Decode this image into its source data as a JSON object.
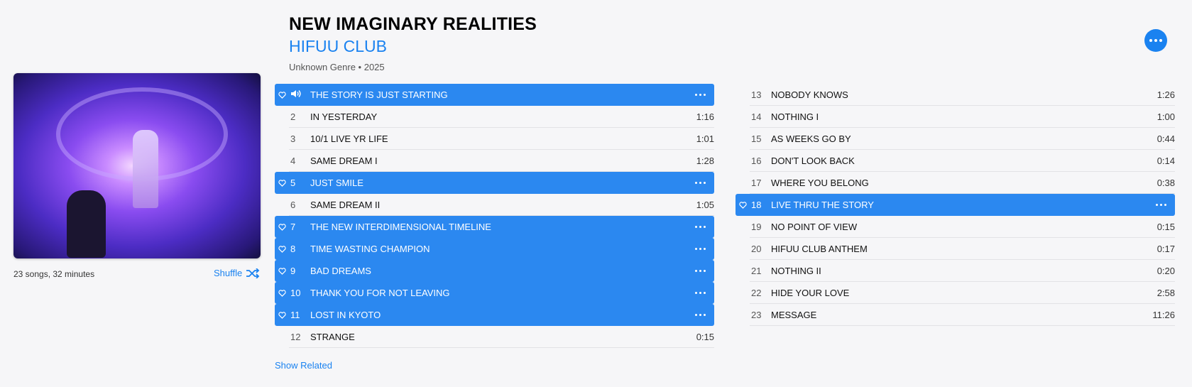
{
  "album": {
    "title": "NEW IMAGINARY REALITIES",
    "artist": "HIFUU CLUB",
    "meta": "Unknown Genre • 2025",
    "summary": "23 songs, 32 minutes",
    "shuffle_label": "Shuffle",
    "show_related_label": "Show Related"
  },
  "colors": {
    "accent": "#1a82f0",
    "selected_row": "#2b88f0"
  },
  "now_playing_icon": "speaker-icon",
  "tracks_left": [
    {
      "num": "",
      "title": "THE STORY IS JUST STARTING",
      "duration": "",
      "selected": true,
      "playing": true
    },
    {
      "num": "2",
      "title": "IN YESTERDAY",
      "duration": "1:16",
      "selected": false
    },
    {
      "num": "3",
      "title": "10/1 LIVE YR LIFE",
      "duration": "1:01",
      "selected": false
    },
    {
      "num": "4",
      "title": "SAME DREAM I",
      "duration": "1:28",
      "selected": false
    },
    {
      "num": "5",
      "title": "JUST SMILE",
      "duration": "",
      "selected": true
    },
    {
      "num": "6",
      "title": "SAME DREAM II",
      "duration": "1:05",
      "selected": false
    },
    {
      "num": "7",
      "title": "THE NEW INTERDIMENSIONAL TIMELINE",
      "duration": "",
      "selected": true
    },
    {
      "num": "8",
      "title": "TIME WASTING CHAMPION",
      "duration": "",
      "selected": true
    },
    {
      "num": "9",
      "title": "BAD DREAMS",
      "duration": "",
      "selected": true
    },
    {
      "num": "10",
      "title": "THANK YOU FOR NOT LEAVING",
      "duration": "",
      "selected": true
    },
    {
      "num": "11",
      "title": "LOST IN KYOTO",
      "duration": "",
      "selected": true
    },
    {
      "num": "12",
      "title": "STRANGE",
      "duration": "0:15",
      "selected": false
    }
  ],
  "tracks_right": [
    {
      "num": "13",
      "title": "NOBODY KNOWS",
      "duration": "1:26",
      "selected": false
    },
    {
      "num": "14",
      "title": "NOTHING I",
      "duration": "1:00",
      "selected": false
    },
    {
      "num": "15",
      "title": "AS WEEKS GO BY",
      "duration": "0:44",
      "selected": false
    },
    {
      "num": "16",
      "title": "DON'T LOOK BACK",
      "duration": "0:14",
      "selected": false
    },
    {
      "num": "17",
      "title": "WHERE YOU BELONG",
      "duration": "0:38",
      "selected": false
    },
    {
      "num": "18",
      "title": "LIVE THRU THE STORY",
      "duration": "",
      "selected": true
    },
    {
      "num": "19",
      "title": "NO POINT OF VIEW",
      "duration": "0:15",
      "selected": false
    },
    {
      "num": "20",
      "title": "HIFUU CLUB ANTHEM",
      "duration": "0:17",
      "selected": false
    },
    {
      "num": "21",
      "title": "NOTHING II",
      "duration": "0:20",
      "selected": false
    },
    {
      "num": "22",
      "title": "HIDE YOUR LOVE",
      "duration": "2:58",
      "selected": false
    },
    {
      "num": "23",
      "title": "MESSAGE",
      "duration": "11:26",
      "selected": false
    }
  ]
}
